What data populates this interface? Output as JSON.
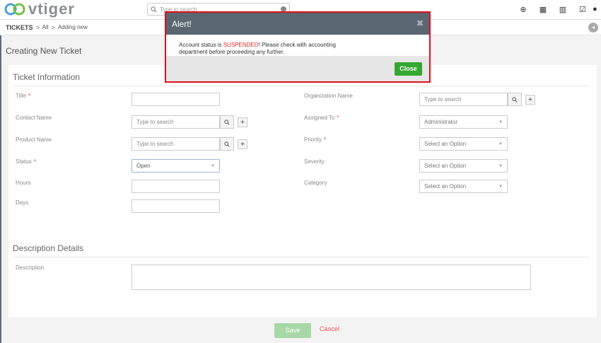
{
  "app": {
    "logo_text": "vtiger",
    "brand_color": "#4aa0d8"
  },
  "global_search": {
    "placeholder": "Type to search"
  },
  "top_icons": [
    "plus-circle-icon",
    "calendar-icon",
    "bar-chart-icon",
    "checkbox-icon",
    "user-icon"
  ],
  "breadcrumb": {
    "module": "TICKETS",
    "items": [
      "All",
      "Adding new"
    ],
    "separator": ">"
  },
  "page_title": "Creating New Ticket",
  "ticket_block": {
    "title": "Ticket Information",
    "fields": {
      "title": {
        "label": "Title",
        "required": "*",
        "value": ""
      },
      "org": {
        "label": "Organization Name",
        "placeholder": "Type to search"
      },
      "contact": {
        "label": "Contact Name",
        "placeholder": "Type to search"
      },
      "assigned": {
        "label": "Assigned To",
        "required": "*",
        "value": "Administrator"
      },
      "product": {
        "label": "Product Name",
        "placeholder": "Type to search"
      },
      "priority": {
        "label": "Priority",
        "required": "*",
        "value": "Select an Option"
      },
      "status": {
        "label": "Status",
        "required": "*",
        "value": "Open"
      },
      "severity": {
        "label": "Severity",
        "value": "Select an Option"
      },
      "hours": {
        "label": "Hours",
        "value": ""
      },
      "category": {
        "label": "Category",
        "value": "Select an Option"
      },
      "days": {
        "label": "Days",
        "value": ""
      }
    }
  },
  "description_block": {
    "title": "Description Details",
    "label": "Description",
    "value": ""
  },
  "footer": {
    "save": "Save",
    "cancel": "Cancel"
  },
  "modal": {
    "title": "Alert!",
    "msg_prefix": "Account status is ",
    "msg_status": "SUSPENDED",
    "msg_suffix": "! Please check with accounting",
    "msg_line2": "department before proceeding any further.",
    "close": "Close",
    "close_color": "#36a832",
    "status_color": "#e22222"
  }
}
